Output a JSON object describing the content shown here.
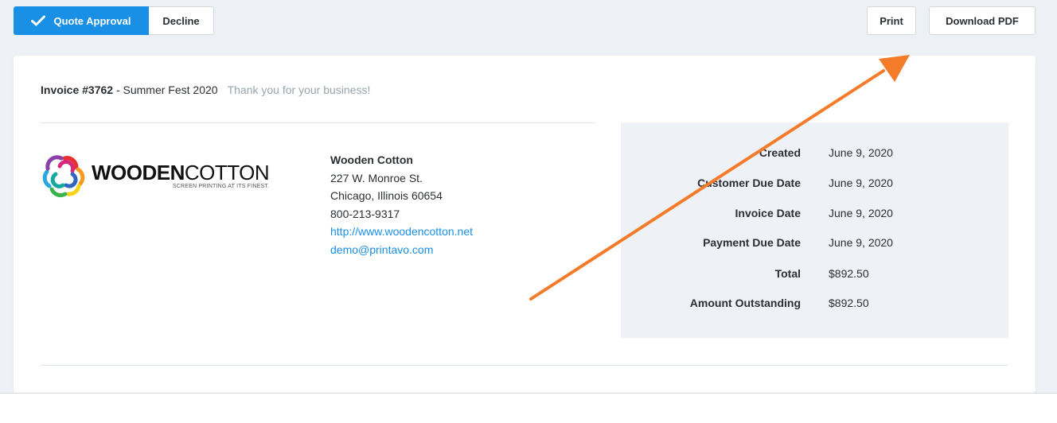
{
  "toolbar": {
    "quote_approval_label": "Quote Approval",
    "decline_label": "Decline",
    "print_label": "Print",
    "download_pdf_label": "Download PDF"
  },
  "invoice": {
    "number": "Invoice #3762",
    "separator": " - ",
    "name": "Summer Fest 2020",
    "thanks": "Thank you for your business!"
  },
  "logo": {
    "word_bold": "WOODEN",
    "word_light": "COTTON",
    "tagline": "SCREEN PRINTING AT ITS FINEST."
  },
  "company": {
    "name": "Wooden Cotton",
    "address_line1": "227 W. Monroe St.",
    "address_line2": "Chicago, Illinois 60654",
    "phone": "800-213-9317",
    "website": "http://www.woodencotton.net",
    "email": "demo@printavo.com"
  },
  "details": [
    {
      "label": "Created",
      "value": "June 9, 2020"
    },
    {
      "label": "Customer Due Date",
      "value": "June 9, 2020"
    },
    {
      "label": "Invoice Date",
      "value": "June 9, 2020"
    },
    {
      "label": "Payment Due Date",
      "value": "June 9, 2020"
    },
    {
      "label": "Total",
      "value": "$892.50"
    },
    {
      "label": "Amount Outstanding",
      "value": "$892.50"
    }
  ],
  "colors": {
    "primary": "#1a8fe6",
    "arrow": "#f47b2a",
    "background": "#edf1f5",
    "details_panel": "#eef1f5"
  },
  "icons": {
    "approve": "check-icon",
    "logo_mark": "flower-logo-icon",
    "annotation": "orange-arrow-annotation"
  }
}
